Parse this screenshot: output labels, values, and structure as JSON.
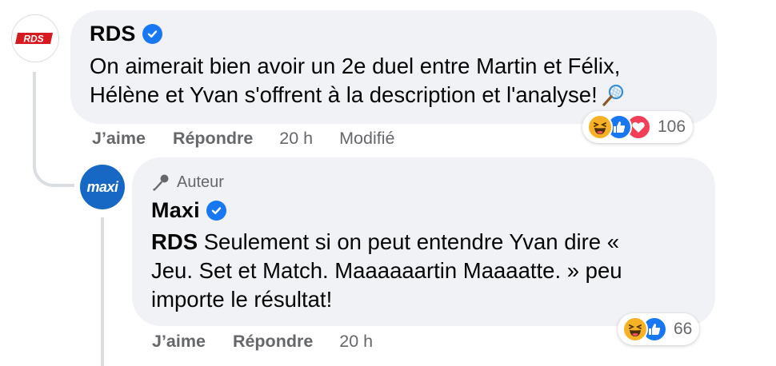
{
  "comment": {
    "author": "RDS",
    "avatar_text": "RDS",
    "text_line1": "On aimerait bien avoir un 2e duel entre Martin et Félix,",
    "text_line2": "Hélène et Yvan s'offrent à la description et l'analyse!",
    "emoji": "tennis-racket-icon",
    "actions": {
      "like": "J’aime",
      "reply": "Répondre",
      "time": "20 h",
      "edited": "Modifié"
    },
    "reactions": {
      "icons": [
        "haha",
        "like",
        "love"
      ],
      "count": "106"
    }
  },
  "reply": {
    "badge": "Auteur",
    "author": "Maxi",
    "avatar_text": "maxi",
    "mention": "RDS",
    "text_line1": " Seulement si on peut entendre Yvan dire «",
    "text_line2": "Jeu. Set et Match. Maaaaaartin Maaaatte. » peu",
    "text_line3": "importe le résultat!",
    "actions": {
      "like": "J’aime",
      "reply": "Répondre",
      "time": "20 h"
    },
    "reactions": {
      "icons": [
        "haha",
        "like"
      ],
      "count": "66"
    }
  },
  "colors": {
    "bubble": "#f0f2f5",
    "secondary_text": "#65676b",
    "verified": "#1877f2",
    "rds_red": "#d71920",
    "maxi_blue": "#1768c5"
  }
}
